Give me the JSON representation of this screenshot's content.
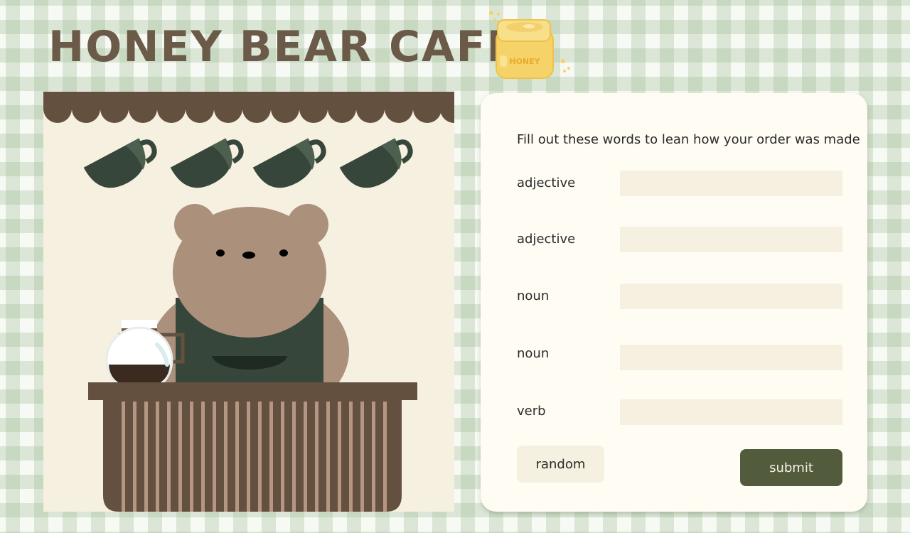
{
  "app": {
    "title": "HONEY BEAR CAFE"
  },
  "logo": {
    "jar_label": "HONEY",
    "icon": "honey-jar-icon"
  },
  "scene": {
    "icons": [
      "coffee-cup-icon",
      "bear-icon",
      "coffee-pot-icon",
      "counter-icon"
    ],
    "cup_count": 4
  },
  "form": {
    "instructions": "Fill out these words to lean how your order was made",
    "fields": [
      {
        "label": "adjective",
        "value": "",
        "placeholder": ""
      },
      {
        "label": "adjective",
        "value": "",
        "placeholder": ""
      },
      {
        "label": "noun",
        "value": "",
        "placeholder": ""
      },
      {
        "label": "noun",
        "value": "",
        "placeholder": ""
      },
      {
        "label": "verb",
        "value": "",
        "placeholder": ""
      }
    ],
    "random_label": "random",
    "submit_label": "submit"
  },
  "colors": {
    "title": "#6b5a48",
    "accent_button": "#525c3c",
    "input_bg": "#f5f0df",
    "card_bg": "#fffcf4",
    "bear_fur": "#ab907c",
    "apron": "#37463a",
    "awning": "#64503f",
    "honey": "#f6d368"
  }
}
